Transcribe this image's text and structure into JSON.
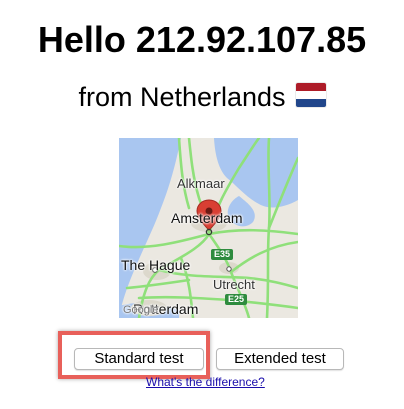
{
  "header": {
    "greeting": "Hello 212.92.107.85",
    "from_line": "from Netherlands"
  },
  "flag": {
    "icon": "netherlands-flag-icon",
    "colors": [
      "#ae1c28",
      "#ffffff",
      "#21468b"
    ]
  },
  "map": {
    "labels": {
      "alkmaar": "Alkmaar",
      "amsterdam": "Amsterdam",
      "the_hague": "The Hague",
      "utrecht": "Utrecht",
      "rotterdam": "Rotterdam",
      "google": "Google"
    },
    "roads": {
      "e35": "E35",
      "e25": "E25"
    },
    "marker_icon": "map-pin-icon"
  },
  "buttons": {
    "standard": "Standard test",
    "extended": "Extended test"
  },
  "link": {
    "difference": "What's the difference?"
  },
  "colors": {
    "highlight": "#e8605a",
    "link": "#1a0dab",
    "marker": "#d93f33"
  }
}
